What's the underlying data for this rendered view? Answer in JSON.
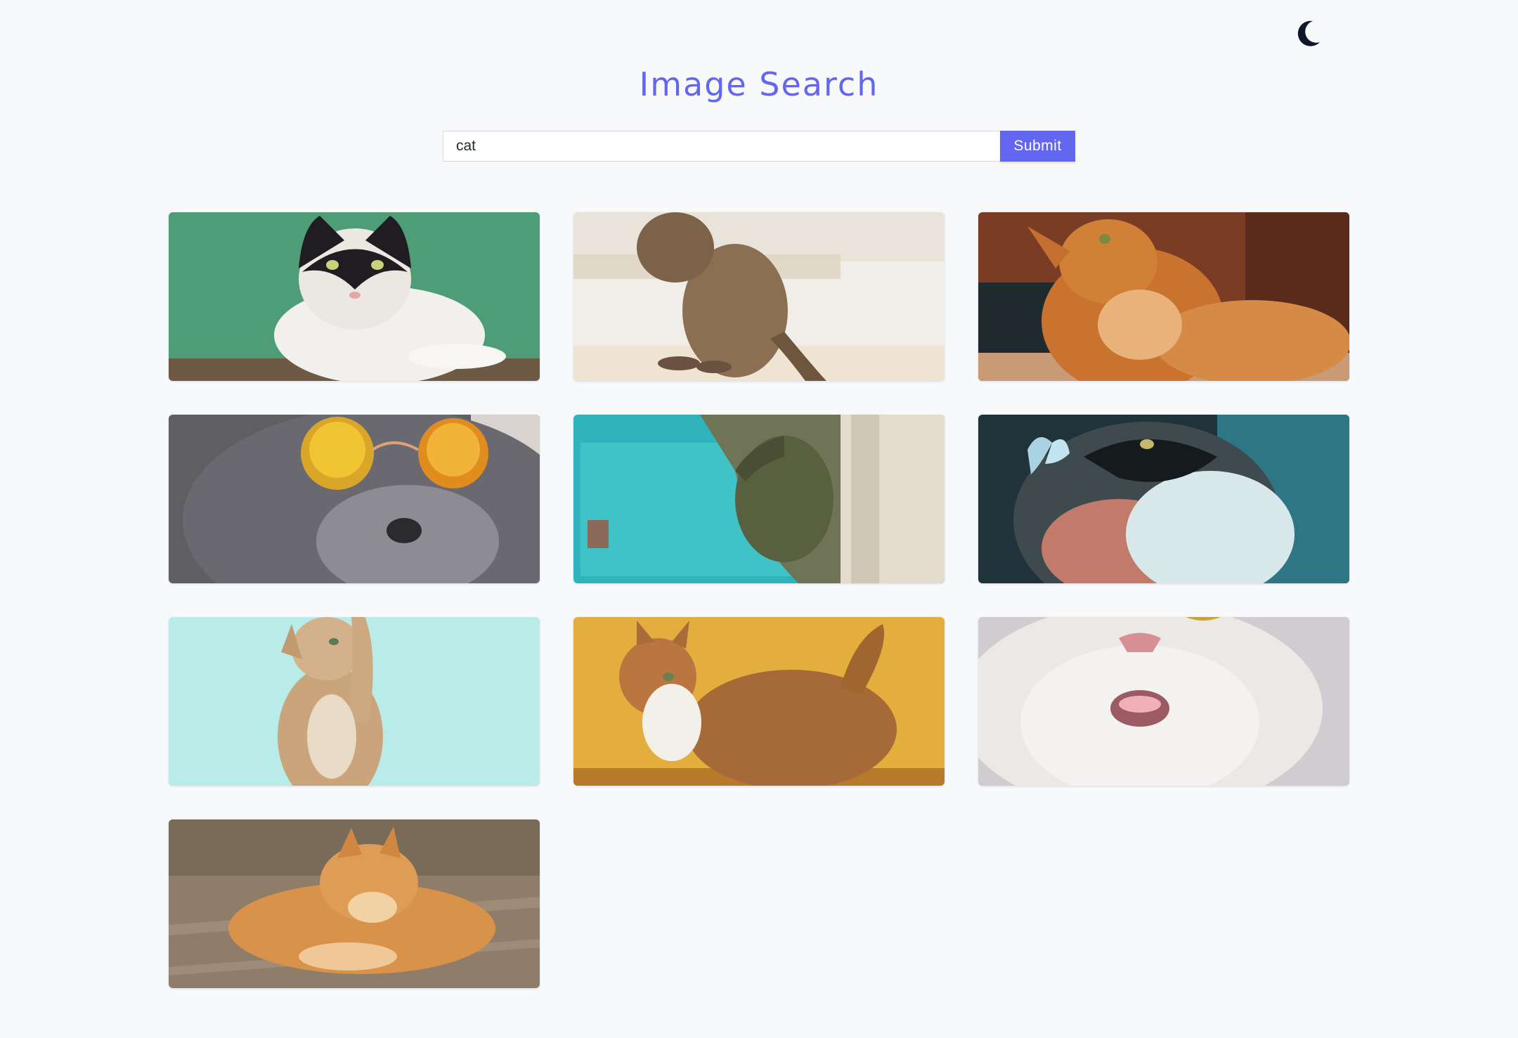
{
  "header": {
    "title": "Image Search",
    "theme_toggle_icon": "moon-icon"
  },
  "search": {
    "value": "cat",
    "placeholder": "",
    "submit_label": "Submit"
  },
  "colors": {
    "accent": "#6366f1",
    "background": "#f8f9fb",
    "moon": "#0f172a"
  },
  "results": [
    {
      "subject": "black-and-white cat on green background",
      "bg": "#4f9d76"
    },
    {
      "subject": "brown tabby cat on stairs",
      "bg": "#ece7de"
    },
    {
      "subject": "orange tabby cat looking up",
      "bg": "#8a4a2a"
    },
    {
      "subject": "grey cat wearing sunglasses",
      "bg": "#6b6a6e"
    },
    {
      "subject": "tabby cat peeking behind teal wall",
      "bg": "#2fb3bd"
    },
    {
      "subject": "fluffy cat with butterfly",
      "bg": "#2a4450"
    },
    {
      "subject": "kitten reaching up on aqua background",
      "bg": "#b9ece8"
    },
    {
      "subject": "orange cat on yellow background",
      "bg": "#e3ae3d"
    },
    {
      "subject": "white cat meowing",
      "bg": "#d9d6d4"
    },
    {
      "subject": "orange tabby cat lying on wood floor",
      "bg": "#85735f"
    }
  ]
}
